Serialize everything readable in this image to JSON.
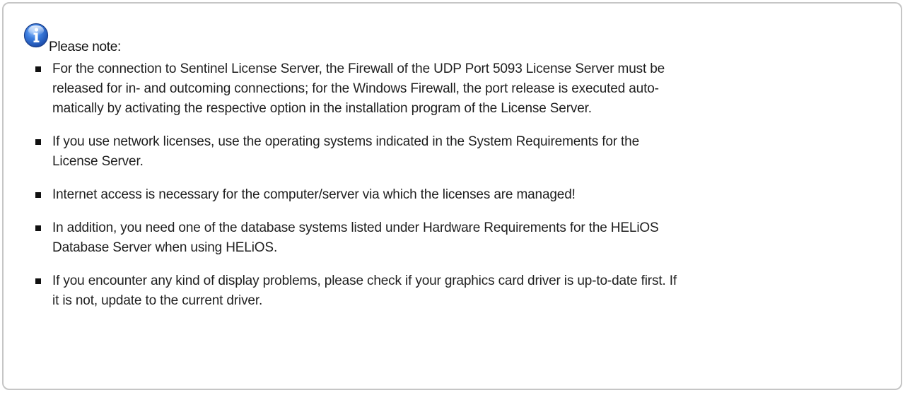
{
  "note": {
    "icon": "info-icon",
    "accent_color": "#2a63c9",
    "title": "Please note:",
    "items": [
      {
        "line1": "For the connection to Sentinel License Server, the Firewall of the UDP Port 5093 License Server must be",
        "line2": "released for in- and outcoming connections; for the Windows Firewall, the port release is executed auto-",
        "line3": "matically by activating the respective option in the installation program of the License Server."
      },
      {
        "line1": "If you use network licenses, use the operating systems indicated in the System Requirements for the",
        "line2": "License Server."
      },
      {
        "line1": "Internet access is necessary for the computer/server via which the licenses are managed!"
      },
      {
        "line1": "In addition, you need one of the database systems listed under Hardware Requirements for the HELiOS",
        "line2": "Database Server when using HELiOS."
      },
      {
        "line1": "If you encounter any kind of display problems, please check if your graphics card driver is up-to-date first. If",
        "line2": "it is not, update to the current driver."
      }
    ]
  }
}
